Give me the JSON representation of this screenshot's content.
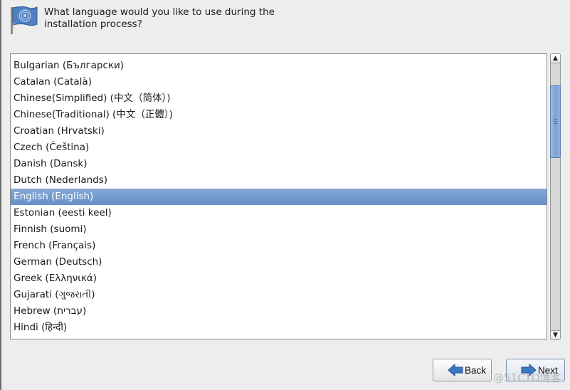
{
  "header": {
    "icon": "flag-icon",
    "question": "What language would you like to use during the installation process?"
  },
  "language_list": {
    "selected_index": 8,
    "items": [
      {
        "label": "Bulgarian (Български)"
      },
      {
        "label": "Catalan (Català)"
      },
      {
        "label": "Chinese(Simplified) (中文（简体）)"
      },
      {
        "label": "Chinese(Traditional) (中文（正體）)"
      },
      {
        "label": "Croatian (Hrvatski)"
      },
      {
        "label": "Czech (Čeština)"
      },
      {
        "label": "Danish (Dansk)"
      },
      {
        "label": "Dutch (Nederlands)"
      },
      {
        "label": "English (English)"
      },
      {
        "label": "Estonian (eesti keel)"
      },
      {
        "label": "Finnish (suomi)"
      },
      {
        "label": "French (Français)"
      },
      {
        "label": "German (Deutsch)"
      },
      {
        "label": "Greek (Ελληνικά)"
      },
      {
        "label": "Gujarati (ગુજરાતી)"
      },
      {
        "label": "Hebrew (עברית)"
      },
      {
        "label": "Hindi (हिन्दी)"
      }
    ]
  },
  "scrollbar": {
    "up_icon": "chevron-up-icon",
    "down_icon": "chevron-down-icon",
    "up_glyph": "▲",
    "down_glyph": "▼"
  },
  "buttons": {
    "back_label": "Back",
    "next_label": "Next",
    "back_icon": "arrow-left-icon",
    "next_icon": "arrow-right-icon"
  },
  "watermark": "@51CTO博客",
  "colors": {
    "selection": "#7199cd",
    "background": "#ededed",
    "arrow_blue": "#3f78c2"
  }
}
